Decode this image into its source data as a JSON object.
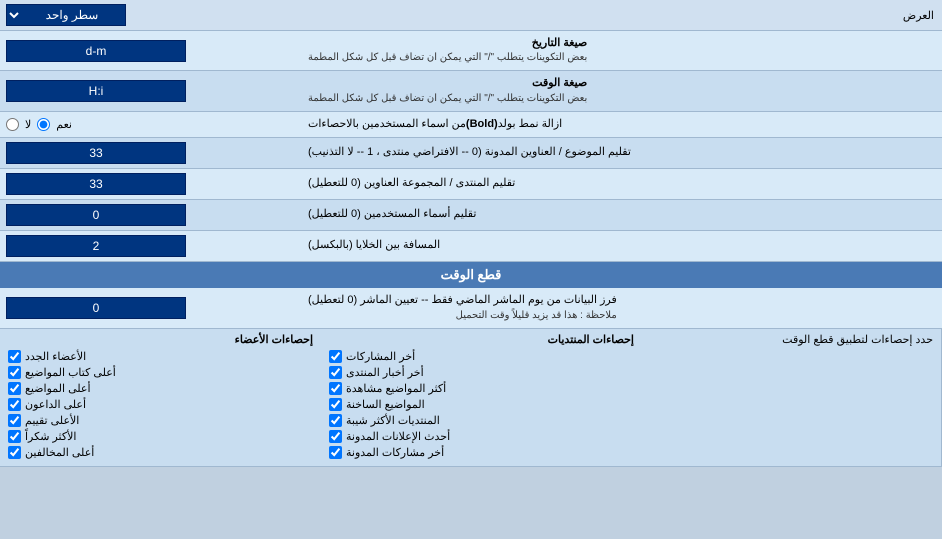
{
  "header": {
    "label": "العرض",
    "dropdown_label": "سطر واحد",
    "dropdown_icon": "▼"
  },
  "rows": [
    {
      "id": "date-format",
      "label": "صيغة التاريخ",
      "sublabel": "بعض التكوينات يتطلب \"/\" التي يمكن ان تضاف قبل كل شكل المطمة",
      "input_value": "d-m",
      "input_type": "text"
    },
    {
      "id": "time-format",
      "label": "صيغة الوقت",
      "sublabel": "بعض التكوينات يتطلب \"/\" التي يمكن ان تضاف قبل كل شكل المطمة",
      "input_value": "H:i",
      "input_type": "text"
    },
    {
      "id": "remove-bold",
      "label": "ازالة نمط بولد (Bold) من اسماء المستخدمين بالاحصاءات",
      "input_type": "radio",
      "radio_options": [
        "نعم",
        "لا"
      ],
      "radio_selected": "نعم"
    },
    {
      "id": "topic-subject",
      "label": "تقليم الموضوع / العناوين المدونة (0 -- الافتراضي منتدى ، 1 -- لا التذنيب)",
      "input_value": "33",
      "input_type": "text"
    },
    {
      "id": "forum-group",
      "label": "تقليم المنتدى / المجموعة العناوين (0 للتعطيل)",
      "input_value": "33",
      "input_type": "text"
    },
    {
      "id": "usernames",
      "label": "تقليم أسماء المستخدمين (0 للتعطيل)",
      "input_value": "0",
      "input_type": "text"
    },
    {
      "id": "cell-spacing",
      "label": "المسافة بين الخلايا (بالبكسل)",
      "input_value": "2",
      "input_type": "text"
    }
  ],
  "cutoff_section": {
    "title": "قطع الوقت",
    "row": {
      "label": "فرز البيانات من يوم الماشر الماضي فقط -- تعيين الماشر (0 لتعطيل)",
      "sublabel": "ملاحظة : هذا قد يزيد قليلاً وقت التحميل",
      "input_value": "0"
    },
    "stats_label": "حدد إحصاءات لتطبيق قطع الوقت"
  },
  "stats": {
    "col1_header": "إحصاءات المنتديات",
    "col2_header": "إحصاءات الأعضاء",
    "col1_items": [
      "أخر المشاركات",
      "أخر أخبار المنتدى",
      "أكثر المواضيع مشاهدة",
      "المواضيع الساخنة",
      "المنتديات الأكثر شيبة",
      "أحدث الإعلانات المدونة",
      "أخر مشاركات المدونة"
    ],
    "col2_items": [
      "الأعضاء الجدد",
      "أعلى كتاب المواضيع",
      "أعلى المواضيع",
      "أعلى الداعون",
      "الأعلى تقييم",
      "الأكثر شكراً",
      "أعلى المخالفين"
    ]
  }
}
